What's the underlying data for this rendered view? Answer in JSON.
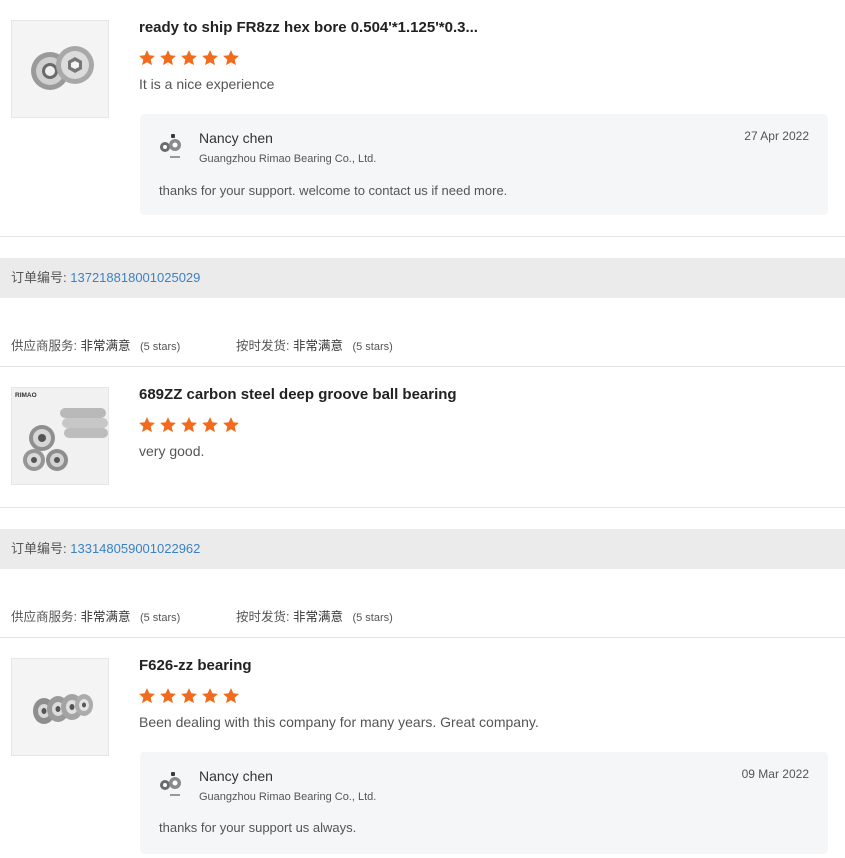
{
  "reviews": [
    {
      "product_title": "ready to ship FR8zz hex bore 0.504'*1.125'*0.3...",
      "rating": 5,
      "comment": "It is a nice experience",
      "reply": {
        "name": "Nancy chen",
        "company": "Guangzhou Rimao Bearing Co., Ltd.",
        "date": "27 Apr 2022",
        "text": "thanks for your support. welcome to contact us if need more."
      }
    },
    {
      "order_label": "订单编号:",
      "order_number": "137218818001025029",
      "supplier_service_label": "供应商服务:",
      "supplier_service_value": "非常满意",
      "supplier_service_stars": "(5 stars)",
      "ontime_label": "按时发货:",
      "ontime_value": "非常满意",
      "ontime_stars": "(5 stars)",
      "product_title": "689ZZ carbon steel deep groove ball bearing",
      "rating": 5,
      "comment": "very good.",
      "thumb_brand": "RIMAO"
    },
    {
      "order_label": "订单编号:",
      "order_number": "133148059001022962",
      "supplier_service_label": "供应商服务:",
      "supplier_service_value": "非常满意",
      "supplier_service_stars": "(5 stars)",
      "ontime_label": "按时发货:",
      "ontime_value": "非常满意",
      "ontime_stars": "(5 stars)",
      "product_title": "F626-zz bearing",
      "rating": 5,
      "comment": "Been dealing with this company for many years.  Great company.",
      "reply": {
        "name": "Nancy chen",
        "company": "Guangzhou Rimao Bearing Co., Ltd.",
        "date": "09 Mar 2022",
        "text": "thanks for your support us always."
      }
    }
  ],
  "colors": {
    "star": "#f26a1b",
    "order_number": "#3b82c4",
    "order_bar": "#ebebeb",
    "reply_bg": "#f5f6f8"
  },
  "icons": {
    "star": "star-icon",
    "avatar": "supplier-logo-icon"
  }
}
